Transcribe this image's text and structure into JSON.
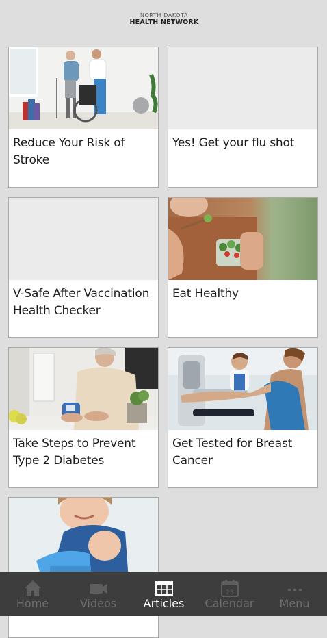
{
  "header": {
    "logo_line1": "NORTH DAKOTA",
    "logo_line2": "HEALTH NETWORK"
  },
  "articles": [
    {
      "title": "Reduce Your Risk of Stroke",
      "image": "physical-therapy-photo"
    },
    {
      "title": "Yes! Get your flu shot",
      "image": ""
    },
    {
      "title": "V-Safe After Vaccination Health Checker",
      "image": ""
    },
    {
      "title": "Eat Healthy",
      "image": "salad-photo"
    },
    {
      "title": "Take Steps to Prevent Type 2 Diabetes",
      "image": "glucose-test-photo"
    },
    {
      "title": "Get Tested for Breast Cancer",
      "image": "mammogram-photo"
    },
    {
      "title": "",
      "image": "child-vaccination-photo"
    }
  ],
  "tabs": [
    {
      "label": "Home",
      "icon": "home-icon",
      "active": false
    },
    {
      "label": "Videos",
      "icon": "video-camera-icon",
      "active": false
    },
    {
      "label": "Articles",
      "icon": "articles-icon",
      "active": true
    },
    {
      "label": "Calendar",
      "icon": "calendar-icon",
      "active": false
    },
    {
      "label": "Menu",
      "icon": "more-dots-icon",
      "active": false
    }
  ],
  "colors": {
    "background": "#dedede",
    "tabbar": "#3d3d3d",
    "tab_active": "#ffffff",
    "tab_inactive": "#6e6e6e"
  }
}
